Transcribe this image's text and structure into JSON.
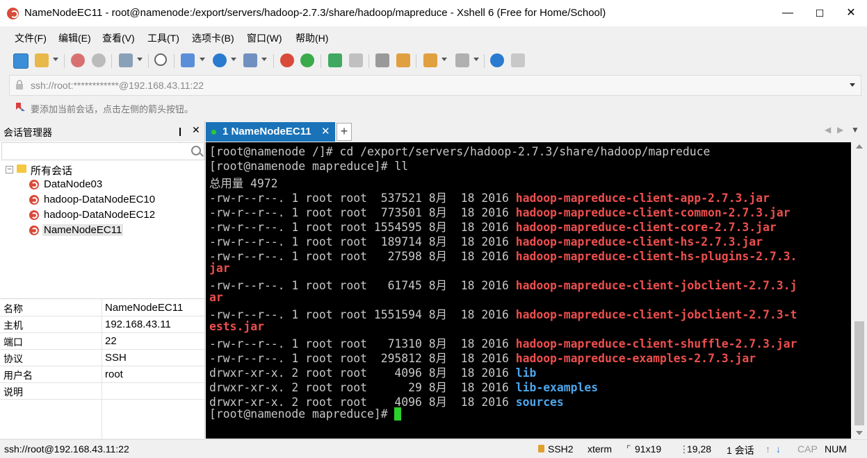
{
  "window": {
    "title": "NameNodeEC11 - root@namenode:/export/servers/hadoop-2.7.3/share/hadoop/mapreduce - Xshell 6 (Free for Home/School)",
    "minimize": "—",
    "maximize": "☐",
    "close": "✕"
  },
  "menu": [
    "文件(F)",
    "编辑(E)",
    "查看(V)",
    "工具(T)",
    "选项卡(B)",
    "窗口(W)",
    "帮助(H)"
  ],
  "address": {
    "value": "ssh://root:************@192.168.43.11:22"
  },
  "hint": "要添加当前会话，点击左侧的箭头按钮。",
  "session_manager": {
    "title": "会话管理器",
    "pin": "❙",
    "close": "✕",
    "folder": "所有会话",
    "sessions": [
      "DataNode03",
      "hadoop-DataNodeEC10",
      "hadoop-DataNodeEC12",
      "NameNodeEC11"
    ],
    "selected": "NameNodeEC11"
  },
  "properties": [
    {
      "key": "名称",
      "value": "NameNodeEC11"
    },
    {
      "key": "主机",
      "value": "192.168.43.11"
    },
    {
      "key": "端口",
      "value": "22"
    },
    {
      "key": "协议",
      "value": "SSH"
    },
    {
      "key": "用户名",
      "value": "root"
    },
    {
      "key": "说明",
      "value": ""
    }
  ],
  "tab": {
    "label": "1 NameNodeEC11",
    "close": "✕",
    "add": "+"
  },
  "terminal": {
    "lines": [
      {
        "segments": [
          {
            "text": "[root@namenode /]# cd /export/servers/hadoop-2.7.3/share/hadoop/mapreduce",
            "cls": ""
          }
        ]
      },
      {
        "segments": [
          {
            "text": "[root@namenode mapreduce]# ll",
            "cls": ""
          }
        ]
      },
      {
        "segments": [
          {
            "text": "总用量 4972",
            "cls": ""
          }
        ]
      },
      {
        "segments": [
          {
            "text": "-rw-r--r--. 1 root root  537521 8月  18 2016 ",
            "cls": ""
          },
          {
            "text": "hadoop-mapreduce-client-app-2.7.3.jar",
            "cls": "jar"
          }
        ]
      },
      {
        "segments": [
          {
            "text": "-rw-r--r--. 1 root root  773501 8月  18 2016 ",
            "cls": ""
          },
          {
            "text": "hadoop-mapreduce-client-common-2.7.3.jar",
            "cls": "jar"
          }
        ]
      },
      {
        "segments": [
          {
            "text": "-rw-r--r--. 1 root root 1554595 8月  18 2016 ",
            "cls": ""
          },
          {
            "text": "hadoop-mapreduce-client-core-2.7.3.jar",
            "cls": "jar"
          }
        ]
      },
      {
        "segments": [
          {
            "text": "-rw-r--r--. 1 root root  189714 8月  18 2016 ",
            "cls": ""
          },
          {
            "text": "hadoop-mapreduce-client-hs-2.7.3.jar",
            "cls": "jar"
          }
        ]
      },
      {
        "segments": [
          {
            "text": "-rw-r--r--. 1 root root   27598 8月  18 2016 ",
            "cls": ""
          },
          {
            "text": "hadoop-mapreduce-client-hs-plugins-2.7.3.",
            "cls": "jar"
          }
        ]
      },
      {
        "segments": [
          {
            "text": "jar",
            "cls": "jar"
          }
        ]
      },
      {
        "segments": [
          {
            "text": "-rw-r--r--. 1 root root   61745 8月  18 2016 ",
            "cls": ""
          },
          {
            "text": "hadoop-mapreduce-client-jobclient-2.7.3.j",
            "cls": "jar"
          }
        ]
      },
      {
        "segments": [
          {
            "text": "ar",
            "cls": "jar"
          }
        ]
      },
      {
        "segments": [
          {
            "text": "-rw-r--r--. 1 root root 1551594 8月  18 2016 ",
            "cls": ""
          },
          {
            "text": "hadoop-mapreduce-client-jobclient-2.7.3-t",
            "cls": "jar"
          }
        ]
      },
      {
        "segments": [
          {
            "text": "ests.jar",
            "cls": "jar"
          }
        ]
      },
      {
        "segments": [
          {
            "text": "-rw-r--r--. 1 root root   71310 8月  18 2016 ",
            "cls": ""
          },
          {
            "text": "hadoop-mapreduce-client-shuffle-2.7.3.jar",
            "cls": "jar"
          }
        ]
      },
      {
        "segments": [
          {
            "text": "-rw-r--r--. 1 root root  295812 8月  18 2016 ",
            "cls": ""
          },
          {
            "text": "hadoop-mapreduce-examples-2.7.3.jar",
            "cls": "jar"
          }
        ]
      },
      {
        "segments": [
          {
            "text": "drwxr-xr-x. 2 root root    4096 8月  18 2016 ",
            "cls": ""
          },
          {
            "text": "lib",
            "cls": "dir"
          }
        ]
      },
      {
        "segments": [
          {
            "text": "drwxr-xr-x. 2 root root      29 8月  18 2016 ",
            "cls": ""
          },
          {
            "text": "lib-examples",
            "cls": "dir"
          }
        ]
      },
      {
        "segments": [
          {
            "text": "drwxr-xr-x. 2 root root    4096 8月  18 2016 ",
            "cls": ""
          },
          {
            "text": "sources",
            "cls": "dir"
          }
        ]
      },
      {
        "segments": [
          {
            "text": "[root@namenode mapreduce]# ",
            "cls": ""
          }
        ]
      }
    ]
  },
  "status": {
    "connection": "ssh://root@192.168.43.11:22",
    "protocol": "SSH2",
    "term": "xterm",
    "size": "91x19",
    "position": "19,28",
    "sessions": "1 会话",
    "caps": "CAP",
    "num": "NUM"
  },
  "colors": {
    "accent": "#1a73b8",
    "jar": "#ee4f4f",
    "dir": "#4ea6ea",
    "cursor": "#2bd02b"
  }
}
